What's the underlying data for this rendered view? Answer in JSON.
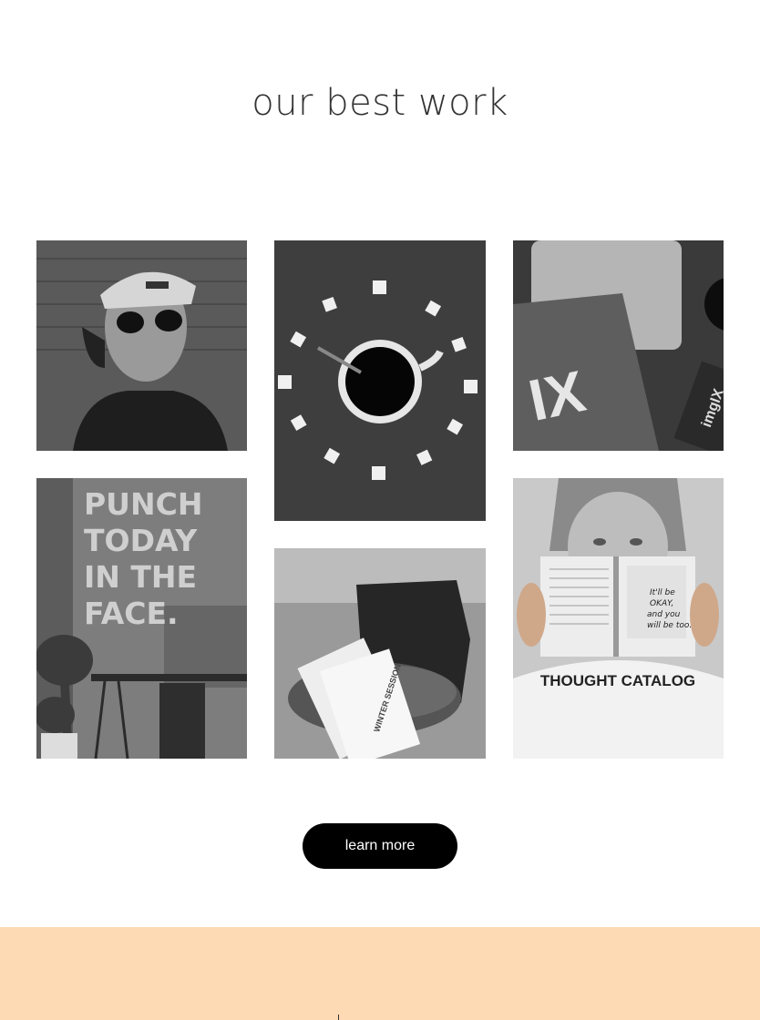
{
  "section": {
    "title": "our best work"
  },
  "gallery": {
    "photos": [
      {
        "name": "portrait-headphones",
        "caption": ""
      },
      {
        "name": "coffee-sugar-clock",
        "caption": ""
      },
      {
        "name": "imgix-notebook-laptop",
        "caption": ""
      },
      {
        "name": "punch-wall-desk",
        "wall_text": [
          "PUNCH",
          "TODAY",
          "IN THE",
          "FACE."
        ]
      },
      {
        "name": "winter-session-cards",
        "card_text": "WINTER SESSION"
      },
      {
        "name": "thought-catalog-reader",
        "shirt_text": "THOUGHT CATALOG",
        "book_text": [
          "It'll be",
          "OKAY,",
          "and you",
          "will be too."
        ]
      }
    ],
    "logo_text": "IX",
    "side_logo_text": "imgIX"
  },
  "cta": {
    "label": "learn more"
  },
  "colors": {
    "band": "#fdd9b4",
    "button": "#000000"
  }
}
